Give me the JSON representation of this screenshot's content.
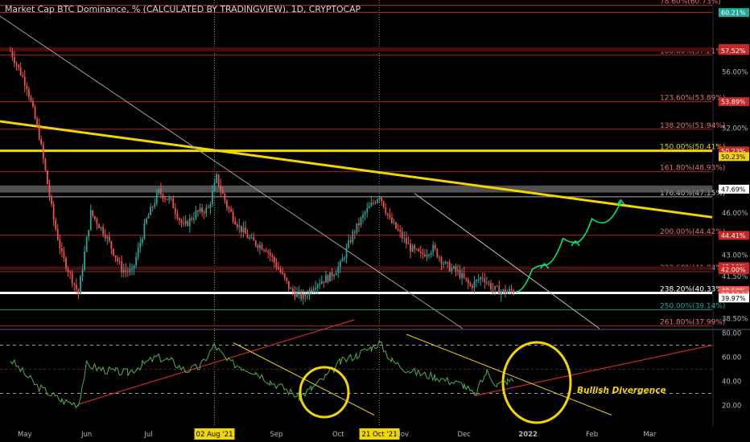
{
  "title": "Market Cap BTC Dominance, % (CALCULATED BY TRADINGVIEW), 1D, CRYPTOCAP",
  "colors": {
    "background": "#000000",
    "up_candle": "#26a69a",
    "down_candle": "#ef5350",
    "fib_line": "#c62828",
    "trendline": "#f2d600",
    "support": "#ffffff",
    "rsi": "#4caf50",
    "projection": "#00e676",
    "highlight_label": "#f2d600"
  },
  "chart_data": [
    {
      "type": "candlestick",
      "series_name": "BTC Dominance",
      "x_labels": [
        "May",
        "Jun",
        "Jul",
        "02 Aug '21",
        "Sep",
        "Oct",
        "21 Oct '21",
        "Nov",
        "Dec",
        "2022",
        "Feb",
        "Mar"
      ],
      "highlighted_dates": [
        "02 Aug '21",
        "21 Oct '21"
      ],
      "y_ticks": [
        "56.00%",
        "52.00%",
        "46.00%",
        "43.00%",
        "41.50%",
        "38.50%"
      ],
      "ylim": [
        38.0,
        61.0
      ],
      "price_path": [
        {
          "t": "2021-04-25",
          "v": 57.5
        },
        {
          "t": "2021-05-03",
          "v": 55.0
        },
        {
          "t": "2021-05-09",
          "v": 51.5
        },
        {
          "t": "2021-05-16",
          "v": 45.5
        },
        {
          "t": "2021-05-20",
          "v": 43.0
        },
        {
          "t": "2021-05-28",
          "v": 40.3
        },
        {
          "t": "2021-06-03",
          "v": 46.0
        },
        {
          "t": "2021-06-10",
          "v": 44.5
        },
        {
          "t": "2021-06-18",
          "v": 42.0
        },
        {
          "t": "2021-06-23",
          "v": 41.8
        },
        {
          "t": "2021-06-30",
          "v": 45.5
        },
        {
          "t": "2021-07-06",
          "v": 47.5
        },
        {
          "t": "2021-07-12",
          "v": 46.8
        },
        {
          "t": "2021-07-18",
          "v": 45.0
        },
        {
          "t": "2021-07-24",
          "v": 46.0
        },
        {
          "t": "2021-07-30",
          "v": 46.3
        },
        {
          "t": "2021-08-03",
          "v": 48.5
        },
        {
          "t": "2021-08-08",
          "v": 46.5
        },
        {
          "t": "2021-08-14",
          "v": 45.0
        },
        {
          "t": "2021-08-20",
          "v": 44.0
        },
        {
          "t": "2021-08-27",
          "v": 43.5
        },
        {
          "t": "2021-09-03",
          "v": 41.8
        },
        {
          "t": "2021-09-08",
          "v": 40.5
        },
        {
          "t": "2021-09-14",
          "v": 40.0
        },
        {
          "t": "2021-09-20",
          "v": 41.0
        },
        {
          "t": "2021-09-27",
          "v": 41.5
        },
        {
          "t": "2021-10-02",
          "v": 42.3
        },
        {
          "t": "2021-10-08",
          "v": 44.5
        },
        {
          "t": "2021-10-14",
          "v": 46.0
        },
        {
          "t": "2021-10-21",
          "v": 47.3
        },
        {
          "t": "2021-10-26",
          "v": 45.5
        },
        {
          "t": "2021-10-31",
          "v": 44.5
        },
        {
          "t": "2021-11-05",
          "v": 43.5
        },
        {
          "t": "2021-11-10",
          "v": 43.0
        },
        {
          "t": "2021-11-16",
          "v": 43.5
        },
        {
          "t": "2021-11-22",
          "v": 42.3
        },
        {
          "t": "2021-11-28",
          "v": 41.8
        },
        {
          "t": "2021-12-04",
          "v": 40.8
        },
        {
          "t": "2021-12-10",
          "v": 41.5
        },
        {
          "t": "2021-12-15",
          "v": 40.6
        },
        {
          "t": "2021-12-21",
          "v": 40.4
        },
        {
          "t": "2021-12-25",
          "v": 40.5
        }
      ],
      "horizontal_levels": [
        {
          "label": "78.60%(60.73%)",
          "value": 60.73,
          "color": "#c62828"
        },
        {
          "label": "100.00%(57.21%)",
          "value": 57.21,
          "color": "#c62828"
        },
        {
          "label": "123.60%(53.89%)",
          "value": 53.89,
          "color": "#c62828"
        },
        {
          "label": "138.20%(51.94%)",
          "value": 51.94,
          "color": "#c62828"
        },
        {
          "label": "150.00%(50.41%)",
          "value": 50.41,
          "color": "#f2d600"
        },
        {
          "label": "161.80%(48.93%)",
          "value": 48.93,
          "color": "#c62828"
        },
        {
          "label": "176.40%(47.15%)",
          "value": 47.15,
          "color": "#c8c8c8"
        },
        {
          "label": "200.00%(44.42%)",
          "value": 44.42,
          "color": "#c62828"
        },
        {
          "label": "223.60%(41.84%)",
          "value": 41.84,
          "color": "#c62828"
        },
        {
          "label": "238.20%(40.33%)",
          "value": 40.33,
          "color": "#ffffff"
        },
        {
          "label": "250.00%(39.14%)",
          "value": 39.14,
          "color": "#26a69a"
        },
        {
          "label": "261.80%(37.99%)",
          "value": 37.99,
          "color": "#c62828"
        }
      ],
      "price_labels": [
        {
          "text": "60.21%",
          "value": 60.21,
          "bg": "#26a69a",
          "fg": "#ffffff"
        },
        {
          "text": "57.66%",
          "value": 57.66,
          "bg": "#c62828",
          "fg": "#ffffff"
        },
        {
          "text": "57.52%",
          "value": 57.52,
          "bg": "#c62828",
          "fg": "#ffffff"
        },
        {
          "text": "53.89%",
          "value": 53.89,
          "bg": "#c62828",
          "fg": "#ffffff"
        },
        {
          "text": "50.23%",
          "value": 50.4,
          "bg": "#c62828",
          "fg": "#ffffff"
        },
        {
          "text": "50.23%",
          "value": 50.0,
          "bg": "#f2d600",
          "fg": "#000000"
        },
        {
          "text": "47.69%",
          "value": 47.69,
          "bg": "#ffffff",
          "fg": "#000000"
        },
        {
          "text": "44.41%",
          "value": 44.41,
          "bg": "#c62828",
          "fg": "#ffffff"
        },
        {
          "text": "42.19%",
          "value": 42.19,
          "bg": "#c62828",
          "fg": "#ffffff"
        },
        {
          "text": "42.00%",
          "value": 41.98,
          "bg": "#c62828",
          "fg": "#ffffff"
        },
        {
          "text": "40.50%",
          "value": 40.5,
          "bg": "#ef5350",
          "fg": "#ffffff"
        },
        {
          "text": "23:12:17",
          "value": 40.22,
          "bg": "#ef5350",
          "fg": "#ffffff"
        },
        {
          "text": "39.97%",
          "value": 39.97,
          "bg": "#ffffff",
          "fg": "#000000"
        }
      ],
      "projection_path": [
        {
          "t": "2021-12-26",
          "v": 40.4
        },
        {
          "t": "2022-01-03",
          "v": 42.0
        },
        {
          "t": "2022-01-09",
          "v": 42.3
        },
        {
          "t": "2022-01-18",
          "v": 44.2
        },
        {
          "t": "2022-01-24",
          "v": 43.9
        },
        {
          "t": "2022-02-01",
          "v": 45.6
        },
        {
          "t": "2022-02-06",
          "v": 45.3
        },
        {
          "t": "2022-02-15",
          "v": 46.8
        }
      ]
    },
    {
      "type": "line",
      "series_name": "RSI",
      "y_ticks": [
        "80.00",
        "60.00",
        "40.00",
        "20.00"
      ],
      "ylim": [
        10,
        85
      ],
      "dashed_levels": [
        70,
        50,
        30
      ],
      "annotation": "Bullish Divergence",
      "values": [
        {
          "t": "2021-04-25",
          "v": 58
        },
        {
          "t": "2021-05-08",
          "v": 36
        },
        {
          "t": "2021-05-20",
          "v": 24
        },
        {
          "t": "2021-05-28",
          "v": 21
        },
        {
          "t": "2021-06-01",
          "v": 54
        },
        {
          "t": "2021-06-08",
          "v": 50
        },
        {
          "t": "2021-06-15",
          "v": 48
        },
        {
          "t": "2021-06-21",
          "v": 47
        },
        {
          "t": "2021-06-28",
          "v": 54
        },
        {
          "t": "2021-07-05",
          "v": 60
        },
        {
          "t": "2021-07-12",
          "v": 57
        },
        {
          "t": "2021-07-19",
          "v": 49
        },
        {
          "t": "2021-07-26",
          "v": 52
        },
        {
          "t": "2021-08-02",
          "v": 70
        },
        {
          "t": "2021-08-08",
          "v": 57
        },
        {
          "t": "2021-08-15",
          "v": 52
        },
        {
          "t": "2021-08-22",
          "v": 48
        },
        {
          "t": "2021-08-29",
          "v": 40
        },
        {
          "t": "2021-09-05",
          "v": 34
        },
        {
          "t": "2021-09-12",
          "v": 27
        },
        {
          "t": "2021-09-18",
          "v": 34
        },
        {
          "t": "2021-09-25",
          "v": 44
        },
        {
          "t": "2021-10-02",
          "v": 56
        },
        {
          "t": "2021-10-10",
          "v": 62
        },
        {
          "t": "2021-10-17",
          "v": 68
        },
        {
          "t": "2021-10-21",
          "v": 72
        },
        {
          "t": "2021-10-27",
          "v": 57
        },
        {
          "t": "2021-11-03",
          "v": 50
        },
        {
          "t": "2021-11-10",
          "v": 46
        },
        {
          "t": "2021-11-17",
          "v": 44
        },
        {
          "t": "2021-11-24",
          "v": 40
        },
        {
          "t": "2021-12-01",
          "v": 37
        },
        {
          "t": "2021-12-06",
          "v": 28
        },
        {
          "t": "2021-12-12",
          "v": 48
        },
        {
          "t": "2021-12-17",
          "v": 37
        },
        {
          "t": "2021-12-22",
          "v": 40
        },
        {
          "t": "2021-12-25",
          "v": 41
        }
      ]
    }
  ]
}
